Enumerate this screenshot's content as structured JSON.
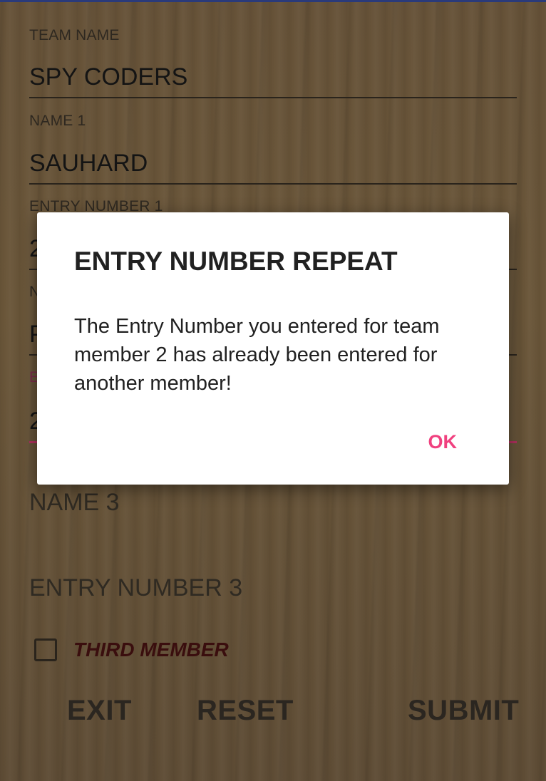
{
  "form": {
    "team_name_label": "TEAM NAME",
    "team_name_value": "SPY CODERS",
    "name1_label": "NAME 1",
    "name1_value": "SAUHARD",
    "entry1_label": "ENTRY NUMBER 1",
    "entry1_value": "2",
    "name2_label": "N",
    "name2_value": "P",
    "entry2_label": "E",
    "entry2_value": "2",
    "name3_hint": "NAME 3",
    "entry3_hint": "ENTRY NUMBER 3",
    "third_member_label": "THIRD MEMBER",
    "third_member_checked": false
  },
  "buttons": {
    "exit": "EXIT",
    "reset": "RESET",
    "submit": "SUBMIT"
  },
  "dialog": {
    "title": "ENTRY NUMBER REPEAT",
    "message": "The Entry Number you entered for team member 2 has already been entered for another member!",
    "ok": "OK"
  },
  "colors": {
    "accent": "#f0417f",
    "dialog_background": "#ffffff",
    "overlay_background": "#5f4f3a"
  }
}
